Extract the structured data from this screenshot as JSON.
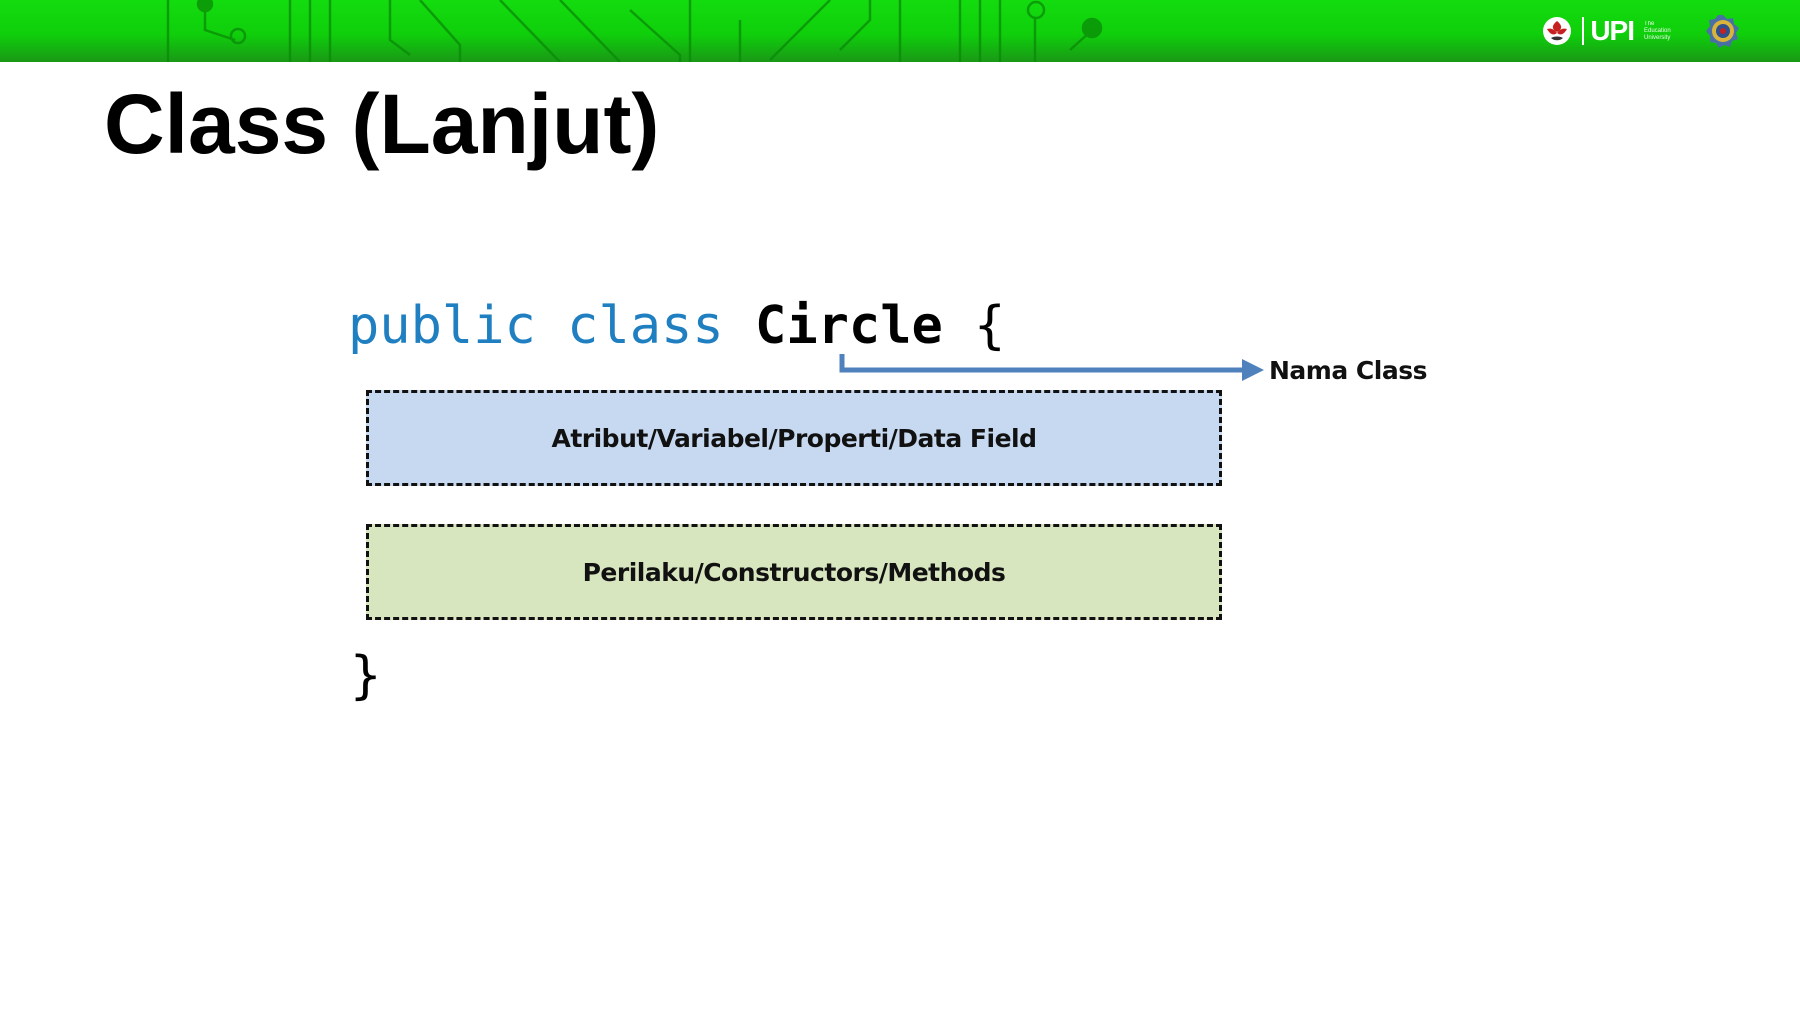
{
  "slide": {
    "title": "Class (Lanjut)"
  },
  "header": {
    "logo_text": "UPI",
    "logo_tagline": "The Education University",
    "icons": [
      "upi-flower-icon",
      "university-seal-icon"
    ],
    "colors": {
      "bar_top": "#13dc0e",
      "bar_bottom": "#199816"
    }
  },
  "diagram": {
    "code": {
      "keyword_public": "public",
      "keyword_class": "class",
      "class_name": "Circle",
      "open_brace": "{",
      "close_brace": "}"
    },
    "annotation": {
      "label": "Nama Class",
      "arrow_color": "#4f81bd"
    },
    "sections": {
      "attributes": "Atribut/Variabel/Properti/Data Field",
      "methods": "Perilaku/Constructors/Methods"
    },
    "colors": {
      "keyword": "#1f7fc0",
      "attributes_fill": "#c7d9f0",
      "methods_fill": "#d8e6c0"
    }
  }
}
